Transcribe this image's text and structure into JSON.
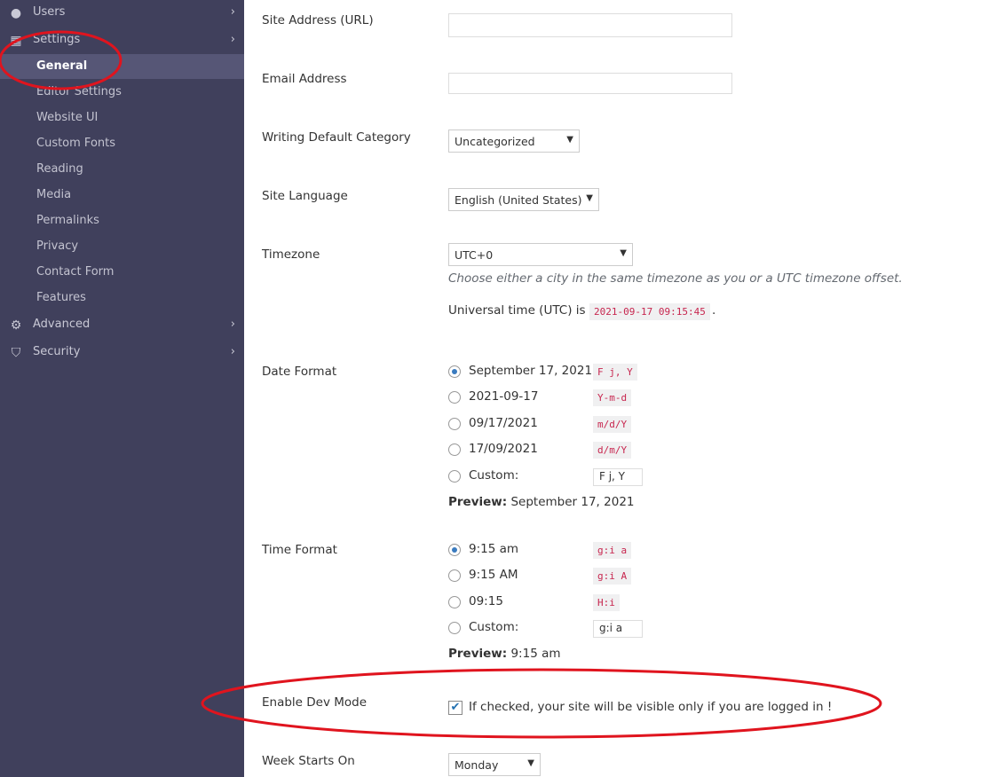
{
  "sidebar": {
    "top": [
      {
        "label": "Users",
        "icon": "user-icon"
      },
      {
        "label": "Settings",
        "icon": "settings-icon"
      }
    ],
    "sub": [
      "General",
      "Editor Settings",
      "Website UI",
      "Custom Fonts",
      "Reading",
      "Media",
      "Permalinks",
      "Privacy",
      "Contact Form",
      "Features"
    ],
    "bottom": [
      {
        "label": "Advanced",
        "icon": "gear-icon"
      },
      {
        "label": "Security",
        "icon": "shield-icon"
      }
    ],
    "active": "General"
  },
  "form": {
    "site_address": {
      "label": "Site Address (URL)",
      "value": ""
    },
    "email": {
      "label": "Email Address",
      "value": ""
    },
    "category": {
      "label": "Writing Default Category",
      "value": "Uncategorized"
    },
    "language": {
      "label": "Site Language",
      "value": "English (United States)"
    },
    "timezone": {
      "label": "Timezone",
      "value": "UTC+0",
      "hint": "Choose either a city in the same timezone as you or a UTC timezone offset.",
      "utc_label": "Universal time (UTC) is",
      "utc_value": "2021-09-17 09:15:45"
    },
    "date_format": {
      "label": "Date Format",
      "options": [
        {
          "text": "September 17, 2021",
          "code": "F j, Y",
          "checked": true
        },
        {
          "text": "2021-09-17",
          "code": "Y-m-d"
        },
        {
          "text": "09/17/2021",
          "code": "m/d/Y"
        },
        {
          "text": "17/09/2021",
          "code": "d/m/Y"
        }
      ],
      "custom_label": "Custom:",
      "custom_value": "F j, Y",
      "preview_label": "Preview:",
      "preview": "September 17, 2021"
    },
    "time_format": {
      "label": "Time Format",
      "options": [
        {
          "text": "9:15 am",
          "code": "g:i a",
          "checked": true
        },
        {
          "text": "9:15 AM",
          "code": "g:i A"
        },
        {
          "text": "09:15",
          "code": "H:i"
        }
      ],
      "custom_label": "Custom:",
      "custom_value": "g:i a",
      "preview_label": "Preview:",
      "preview": "9:15 am"
    },
    "dev_mode": {
      "label": "Enable Dev Mode",
      "text": "If checked, your site will be visible only if you are logged in !",
      "checked": true
    },
    "week_start": {
      "label": "Week Starts On",
      "value": "Monday"
    }
  },
  "annotation_color": "#e0141e"
}
